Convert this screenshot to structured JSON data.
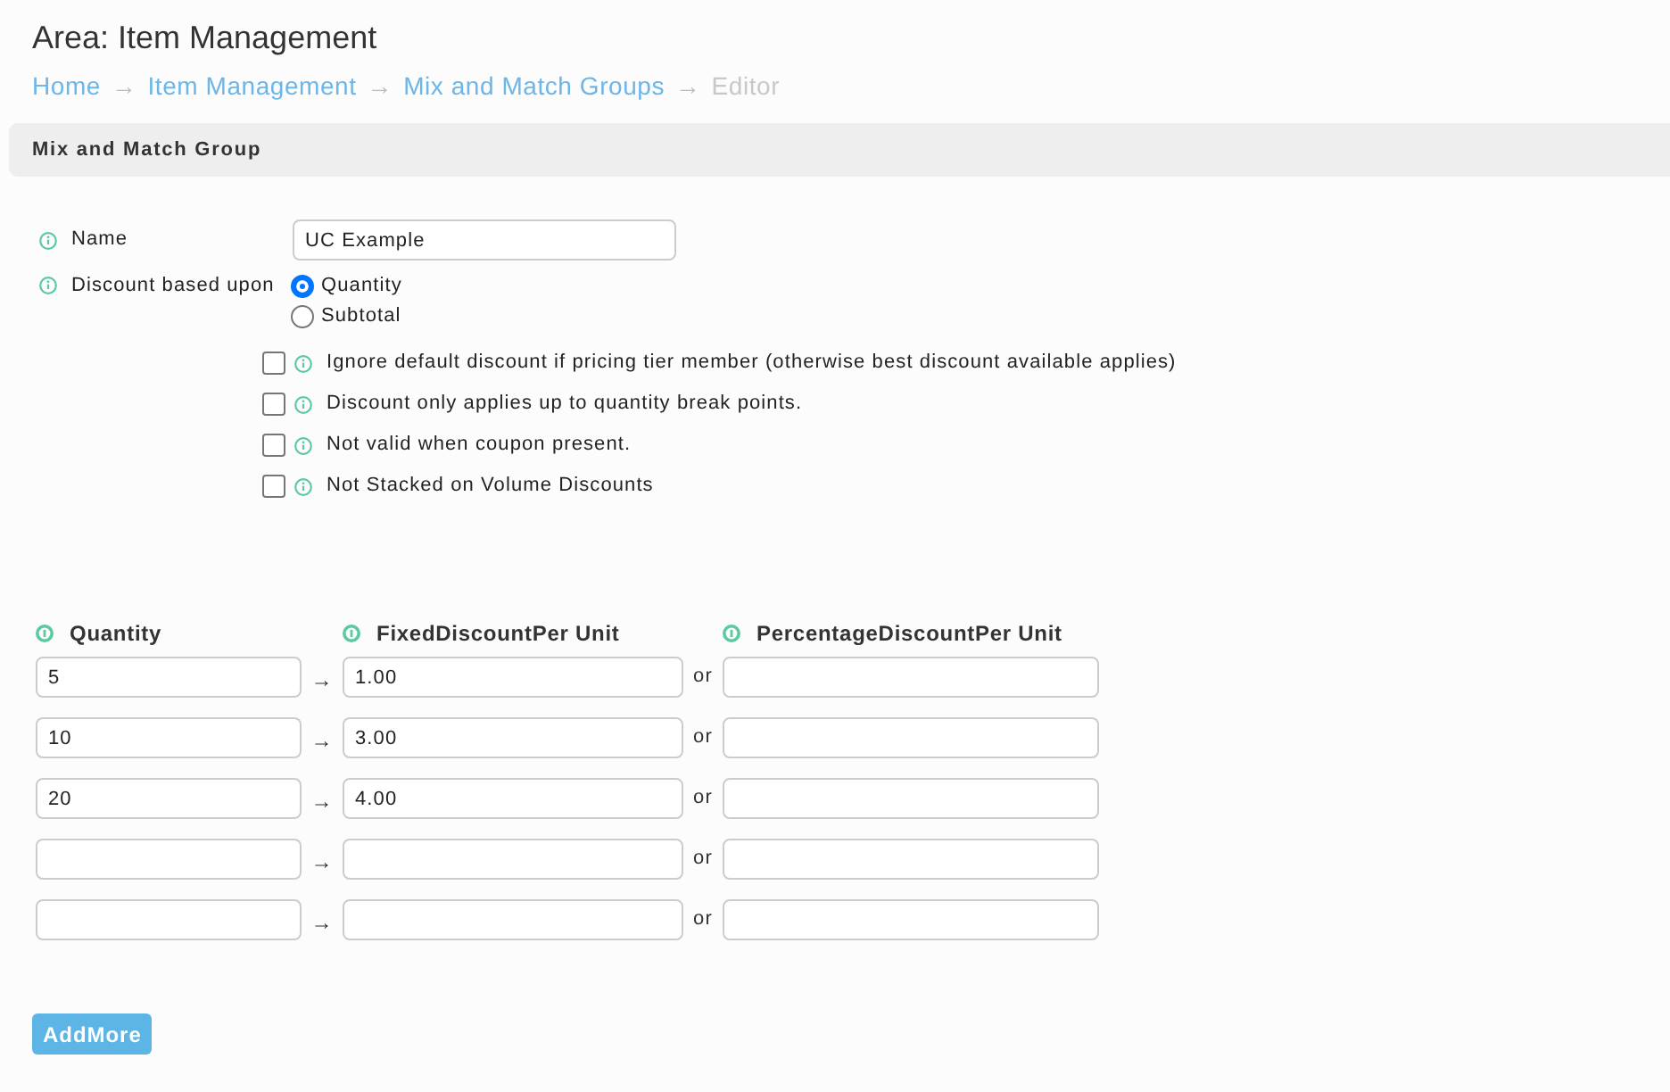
{
  "area_title": "Area: Item Management",
  "breadcrumb": [
    {
      "label": "Home",
      "current": false,
      "separator": "→"
    },
    {
      "label": "Item Management",
      "current": false,
      "separator": "→"
    },
    {
      "label": "Mix and Match Groups",
      "current": false,
      "separator": "→"
    },
    {
      "label": "Editor",
      "current": true
    }
  ],
  "panel": {
    "title": "Mix and Match Group",
    "name_field": {
      "label": "Name",
      "value": "UC Example"
    },
    "discount_based_upon": {
      "label": "Discount based upon",
      "options": [
        {
          "label": "Quantity",
          "selected": true
        },
        {
          "label": "Subtotal",
          "selected": false
        }
      ]
    },
    "checkboxes": [
      {
        "label": "Ignore default discount if pricing tier member (otherwise best discount available applies)",
        "checked": false
      },
      {
        "label": "Discount only applies up to quantity break points.",
        "checked": false
      },
      {
        "label": "Not valid when coupon present.",
        "checked": false
      },
      {
        "label": "Not Stacked on Volume Discounts",
        "checked": false
      }
    ],
    "discount_table": {
      "columns": [
        "Quantity",
        "FixedDiscountPer Unit",
        "PercentageDiscountPer Unit"
      ],
      "rows": [
        {
          "quantity": "5",
          "arrow": "→",
          "fixed_discount": "1.00",
          "or": "or"
        },
        {
          "quantity": "10",
          "arrow": "→",
          "fixed_discount": "3.00",
          "or": "or"
        },
        {
          "quantity": "20",
          "arrow": "→",
          "fixed_discount": "4.00",
          "or": "or"
        },
        {
          "arrow": "→",
          "or": "or"
        },
        {
          "arrow": "→",
          "or": "or"
        }
      ]
    },
    "add_more_button": "AddMore"
  }
}
